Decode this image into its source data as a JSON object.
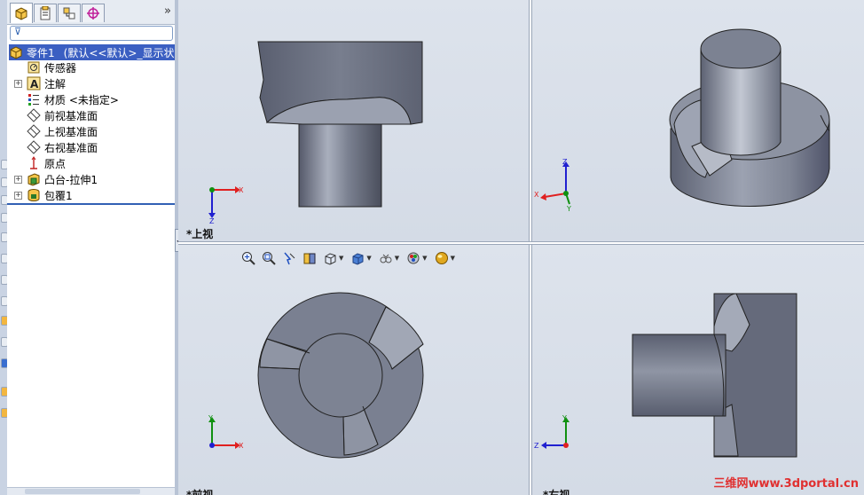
{
  "feature_tree": {
    "expand_symbol": "»",
    "filter_symbol": "⊽",
    "root": {
      "label": "零件1",
      "config": "(默认<<默认>_显示状态"
    },
    "items": [
      {
        "label": "传感器"
      },
      {
        "label": "注解"
      },
      {
        "label": "材质 <未指定>"
      },
      {
        "label": "前视基准面"
      },
      {
        "label": "上视基准面"
      },
      {
        "label": "右视基准面"
      },
      {
        "label": "原点"
      },
      {
        "label": "凸台-拉伸1"
      },
      {
        "label": "包覆1"
      }
    ]
  },
  "splitter_symbol": "◂",
  "viewports": {
    "top": {
      "label": "*上视",
      "triad": {
        "h": "X",
        "v": "Z"
      }
    },
    "iso": {
      "triad": {
        "a": "Z",
        "b": "X",
        "c": "Y"
      }
    },
    "front": {
      "label": "*前视",
      "triad": {
        "h": "X",
        "v": "Y"
      }
    },
    "right": {
      "label": "*右视",
      "triad": {
        "h": "Z",
        "v": "Y"
      }
    }
  },
  "watermark": "三维网www.3dportal.cn",
  "colors": {
    "selection": "#3b5fc2",
    "part_body": "#6f7585",
    "triad_x": "#e02020",
    "triad_y": "#109010",
    "triad_z": "#2020d0"
  }
}
